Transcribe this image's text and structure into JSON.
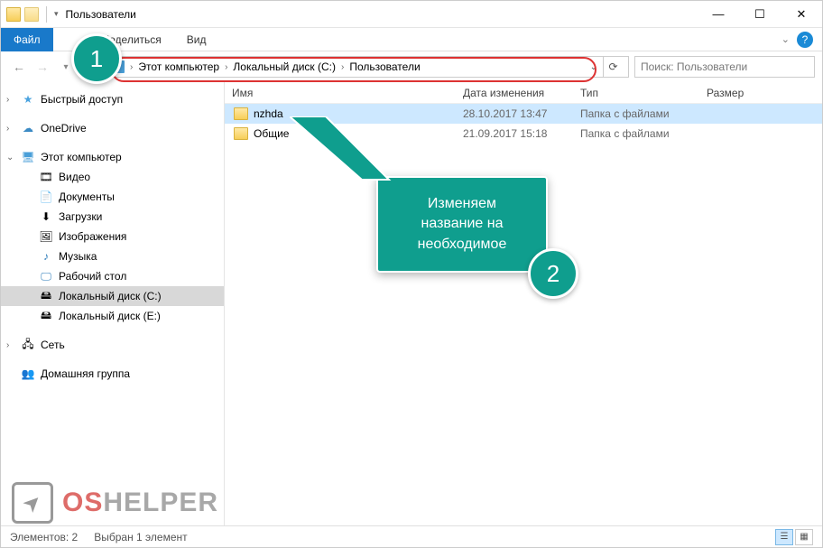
{
  "window": {
    "title": "Пользователи"
  },
  "ribbon": {
    "file": "Файл",
    "share": "Поделиться",
    "view": "Вид"
  },
  "breadcrumb": {
    "seg1": "Этот компьютер",
    "seg2": "Локальный диск (C:)",
    "seg3": "Пользователи"
  },
  "search": {
    "placeholder": "Поиск: Пользователи"
  },
  "columns": {
    "name": "Имя",
    "date": "Дата изменения",
    "type": "Тип",
    "size": "Размер"
  },
  "rows": [
    {
      "name": "nzhda",
      "date": "28.10.2017 13:47",
      "type": "Папка с файлами",
      "selected": true
    },
    {
      "name": "Общие",
      "date": "21.09.2017 15:18",
      "type": "Папка с файлами",
      "selected": false
    }
  ],
  "nav": {
    "quick": "Быстрый доступ",
    "onedrive": "OneDrive",
    "thispc": "Этот компьютер",
    "video": "Видео",
    "docs": "Документы",
    "downloads": "Загрузки",
    "pictures": "Изображения",
    "music": "Музыка",
    "desktop": "Рабочий стол",
    "diskc": "Локальный диск (C:)",
    "diske": "Локальный диск (E:)",
    "network": "Сеть",
    "homegroup": "Домашняя группа"
  },
  "status": {
    "count": "Элементов: 2",
    "selected": "Выбран 1 элемент"
  },
  "annotations": {
    "badge1": "1",
    "badge2": "2",
    "callout_l1": "Изменяем",
    "callout_l2": "название на",
    "callout_l3": "необходимое"
  },
  "watermark": {
    "os": "OS",
    "helper": "HELPER"
  }
}
